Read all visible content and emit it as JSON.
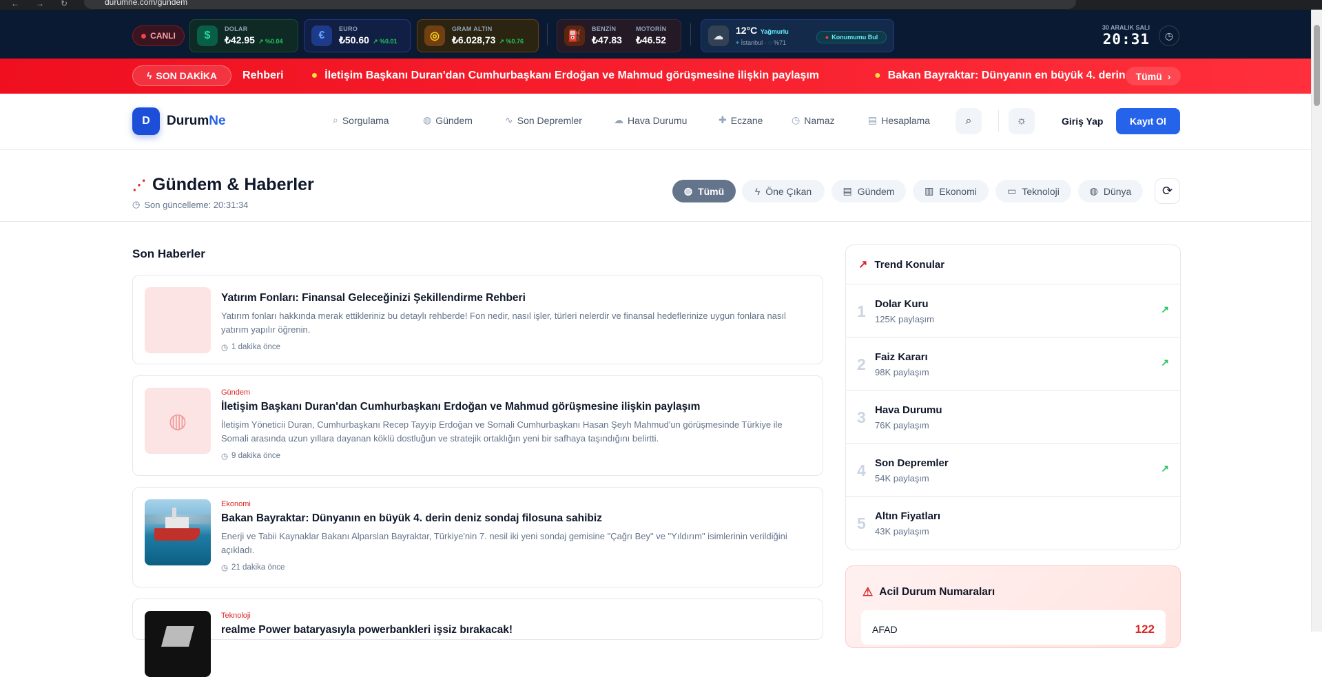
{
  "browser": {
    "url": "durumne.com/gundem"
  },
  "topbar": {
    "live_label": "CANLI",
    "dolar": {
      "label": "DOLAR",
      "value": "₺42.95",
      "change": "%0.04"
    },
    "euro": {
      "label": "EURO",
      "value": "₺50.60",
      "change": "%0.01"
    },
    "gold": {
      "label": "GRAM ALTIN",
      "value": "₺6.028,73",
      "change": "%0.76"
    },
    "fuel": {
      "benzin_label": "BENZİN",
      "benzin_value": "₺47.83",
      "motorin_label": "MOTORİN",
      "motorin_value": "₺46.52"
    },
    "weather": {
      "temp": "12°C",
      "condition": "Yağmurlu",
      "city": "İstanbul",
      "humidity": "%71",
      "locate_label": "Konumumu Bul"
    },
    "date": "30 ARALIK SALI",
    "time": "20:31"
  },
  "breaking": {
    "badge": "SON DAKİKA",
    "items": [
      "Rehberi",
      "İletişim Başkanı Duran'dan Cumhurbaşkanı Erdoğan ve Mahmud görüşmesine ilişkin paylaşım",
      "Bakan Bayraktar: Dünyanın en büyük 4. derin"
    ],
    "all_label": "Tümü"
  },
  "header": {
    "logo_mark": "D",
    "logo_name_1": "Durum",
    "logo_name_2": "Ne",
    "nav": [
      "Sorgulama",
      "Gündem",
      "Son Depremler",
      "Hava Durumu",
      "Eczane",
      "Namaz",
      "Hesaplama"
    ],
    "login": "Giriş Yap",
    "signup": "Kayıt Ol"
  },
  "page": {
    "title": "Gündem & Haberler",
    "updated": "Son güncelleme: 20:31:34",
    "filters": [
      "Tümü",
      "Öne Çıkan",
      "Gündem",
      "Ekonomi",
      "Teknoloji",
      "Dünya"
    ]
  },
  "news": {
    "section_title": "Son Haberler",
    "items": [
      {
        "category": "",
        "title": "Yatırım Fonları: Finansal Geleceğinizi Şekillendirme Rehberi",
        "desc": "Yatırım fonları hakkında merak ettikleriniz bu detaylı rehberde! Fon nedir, nasıl işler, türleri nelerdir ve finansal hedeflerinize uygun fonlara nasıl yatırım yapılır öğrenin.",
        "time": "1 dakika önce"
      },
      {
        "category": "Gündem",
        "title": "İletişim Başkanı Duran'dan Cumhurbaşkanı Erdoğan ve Mahmud görüşmesine ilişkin paylaşım",
        "desc": "İletişim Yöneticii Duran, Cumhurbaşkanı Recep Tayyip Erdoğan ve Somali Cumhurbaşkanı Hasan Şeyh Mahmud'un görüşmesinde Türkiye ile Somali arasında uzun yıllara dayanan köklü dostluğun ve stratejik ortaklığın yeni bir safhaya taşındığını belirtti.",
        "time": "9 dakika önce"
      },
      {
        "category": "Ekonomi",
        "title": "Bakan Bayraktar: Dünyanın en büyük 4. derin deniz sondaj filosuna sahibiz",
        "desc": "Enerji ve Tabii Kaynaklar Bakanı Alparslan Bayraktar, Türkiye'nin 7. nesil iki yeni sondaj gemisine \"Çağrı Bey\" ve \"Yıldırım\" isimlerinin verildiğini açıkladı.",
        "time": "21 dakika önce"
      },
      {
        "category": "Teknoloji",
        "title": "realme Power bataryasıyla powerbankleri işsiz bırakacak!",
        "desc": "",
        "time": ""
      }
    ]
  },
  "trends": {
    "title": "Trend Konular",
    "items": [
      {
        "rank": "1",
        "name": "Dolar Kuru",
        "shares": "125K paylaşım",
        "rising": true
      },
      {
        "rank": "2",
        "name": "Faiz Kararı",
        "shares": "98K paylaşım",
        "rising": true
      },
      {
        "rank": "3",
        "name": "Hava Durumu",
        "shares": "76K paylaşım",
        "rising": false
      },
      {
        "rank": "4",
        "name": "Son Depremler",
        "shares": "54K paylaşım",
        "rising": true
      },
      {
        "rank": "5",
        "name": "Altın Fiyatları",
        "shares": "43K paylaşım",
        "rising": false
      }
    ]
  },
  "emergency": {
    "title": "Acil Durum Numaraları",
    "rows": [
      {
        "label": "AFAD",
        "number": "122"
      }
    ]
  }
}
